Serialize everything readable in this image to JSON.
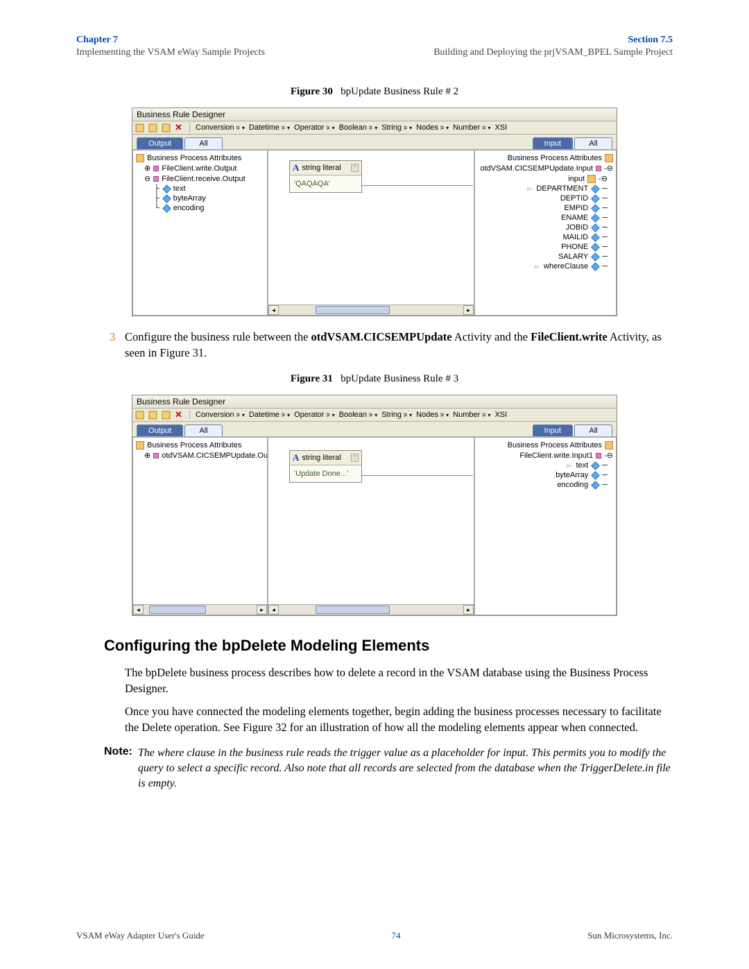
{
  "header": {
    "chapter": "Chapter 7",
    "section": "Section 7.5",
    "sub_left": "Implementing the VSAM eWay Sample Projects",
    "sub_right": "Building and Deploying the prjVSAM_BPEL Sample Project"
  },
  "figure30": {
    "caption_bold": "Figure 30",
    "caption_rest": "bpUpdate Business Rule # 2",
    "designer_title": "Business Rule Designer",
    "toolbar": {
      "menus": [
        "Conversion",
        "Datetime",
        "Operator",
        "Boolean",
        "String",
        "Nodes",
        "Number",
        "XSI"
      ]
    },
    "tabs_left": {
      "active": "Output",
      "other": "All"
    },
    "tabs_right": {
      "active": "Input",
      "other": "All"
    },
    "left_tree": {
      "root": "Business Process Attributes",
      "items": [
        "FileClient.write.Output",
        "FileClient.receive.Output"
      ],
      "subitems": [
        "text",
        "byteArray",
        "encoding"
      ]
    },
    "right_tree": {
      "root": "Business Process Attributes",
      "parent": "otdVSAM.CICSEMPUpdate.Input",
      "sub": "input",
      "fields": [
        "DEPARTMENT",
        "DEPTID",
        "EMPID",
        "ENAME",
        "JOBID",
        "MAILID",
        "PHONE",
        "SALARY",
        "whereClause"
      ]
    },
    "literal": {
      "label": "string literal",
      "value": "'QAQAQA'"
    }
  },
  "step3": {
    "num": "3",
    "text_pre": "Configure the business rule between the ",
    "bold1": "otdVSAM.CICSEMPUpdate",
    "text_mid": " Activity and the ",
    "bold2": "FileClient.write",
    "text_end": " Activity, as seen in Figure 31."
  },
  "figure31": {
    "caption_bold": "Figure 31",
    "caption_rest": "bpUpdate Business Rule # 3",
    "designer_title": "Business Rule Designer",
    "toolbar": {
      "menus": [
        "Conversion",
        "Datetime",
        "Operator",
        "Boolean",
        "String",
        "Nodes",
        "Number",
        "XSI"
      ]
    },
    "tabs_left": {
      "active": "Output",
      "other": "All"
    },
    "tabs_right": {
      "active": "Input",
      "other": "All"
    },
    "left_tree": {
      "root": "Business Process Attributes",
      "item": "otdVSAM.CICSEMPUpdate.Outpu"
    },
    "right_tree": {
      "root": "Business Process Attributes",
      "parent": "FileClient.write.Input1",
      "fields": [
        "text",
        "byteArray",
        "encoding"
      ]
    },
    "literal": {
      "label": "string literal",
      "value": "'Update Done...'"
    }
  },
  "section_heading": "Configuring the bpDelete Modeling Elements",
  "para1": "The bpDelete business process describes how to delete a record in the VSAM database using the Business Process Designer.",
  "para2": "Once you have connected the modeling elements together, begin adding the business processes necessary to facilitate the Delete operation. See Figure 32 for an illustration of how all the modeling elements appear when connected.",
  "note": {
    "label": "Note:",
    "body": "The where clause in the business rule reads the trigger value as a placeholder for input. This permits you to modify the query to select a specific record. Also note that all records are selected from the database when the TriggerDelete.in file is empty."
  },
  "footer": {
    "left": "VSAM eWay Adapter User's Guide",
    "page": "74",
    "right": "Sun Microsystems, Inc."
  }
}
